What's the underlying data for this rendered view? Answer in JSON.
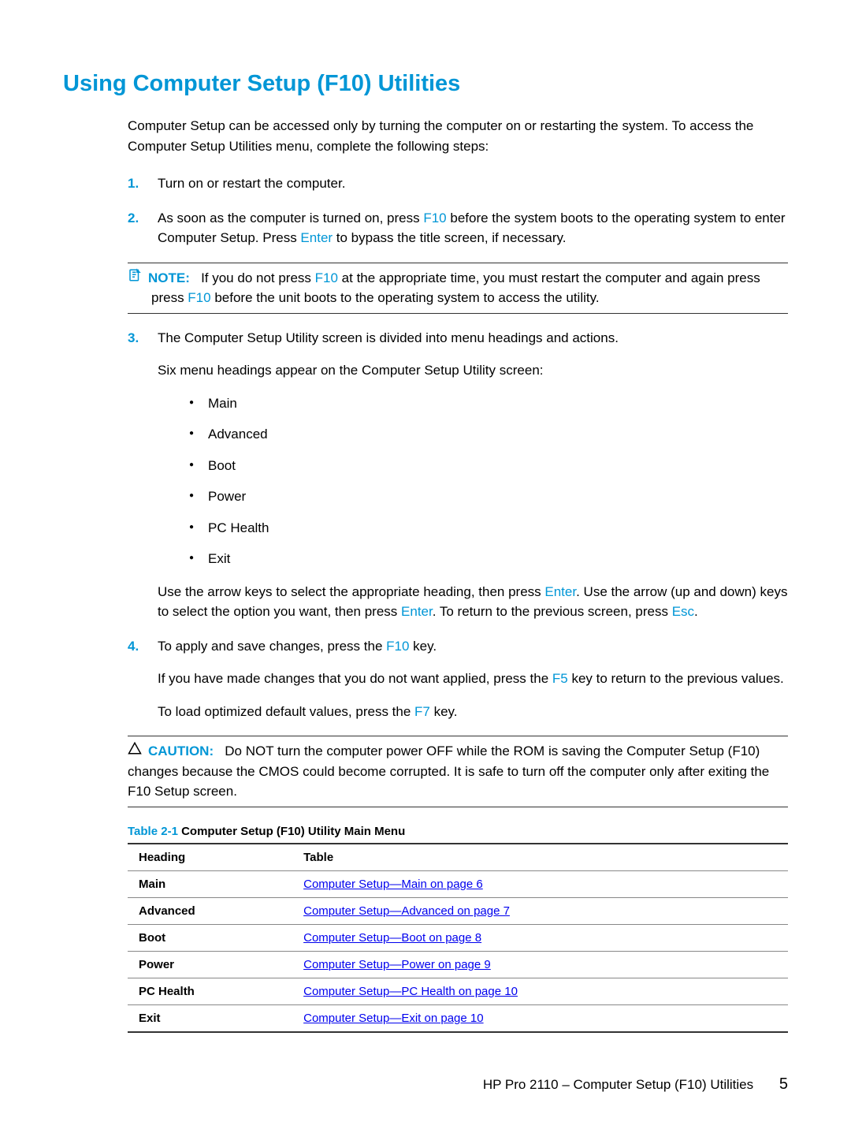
{
  "title": "Using Computer Setup (F10) Utilities",
  "intro": "Computer Setup can be accessed only by turning the computer on or restarting the system. To access the Computer Setup Utilities menu, complete the following steps:",
  "steps": {
    "s1_num": "1.",
    "s1_text": "Turn on or restart the computer.",
    "s2_num": "2.",
    "s2_a": "As soon as the computer is turned on, press ",
    "s2_key1": "F10",
    "s2_b": " before the system boots to the operating system to enter Computer Setup. Press ",
    "s2_key2": "Enter",
    "s2_c": " to bypass the title screen, if necessary.",
    "s3_num": "3.",
    "s3_text": "The Computer Setup Utility screen is divided into menu headings and actions.",
    "s3_sub": "Six menu headings appear on the Computer Setup Utility screen:",
    "s3_use_a": "Use the arrow keys to select the appropriate heading, then press ",
    "s3_use_key1": "Enter",
    "s3_use_b": ". Use the arrow (up and down) keys to select the option you want, then press ",
    "s3_use_key2": "Enter",
    "s3_use_c": ". To return to the previous screen, press ",
    "s3_use_key3": "Esc",
    "s3_use_d": ".",
    "s4_num": "4.",
    "s4_a": "To apply and save changes, press the ",
    "s4_key": "F10",
    "s4_b": " key.",
    "s4_p2_a": "If you have made changes that you do not want applied, press the ",
    "s4_p2_key": "F5",
    "s4_p2_b": " key to return to the previous values.",
    "s4_p3_a": "To load optimized default values, press the ",
    "s4_p3_key": "F7",
    "s4_p3_b": " key."
  },
  "menu_items": [
    "Main",
    "Advanced",
    "Boot",
    "Power",
    "PC Health",
    "Exit"
  ],
  "note": {
    "label": "NOTE:",
    "a": "If you do not press ",
    "key1": "F10",
    "b": " at the appropriate time, you must restart the computer and again press ",
    "key2": "F10",
    "c": " before the unit boots to the operating system to access the utility."
  },
  "caution": {
    "label": "CAUTION:",
    "text": "Do NOT turn the computer power OFF while the ROM is saving the Computer Setup (F10) changes because the CMOS could become corrupted. It is safe to turn off the computer only after exiting the F10 Setup screen."
  },
  "table": {
    "title_prefix": "Table 2-1",
    "title_text": "  Computer Setup (F10) Utility Main Menu",
    "col1": "Heading",
    "col2": "Table",
    "rows": [
      {
        "h": "Main",
        "link": "Computer Setup—Main on page 6"
      },
      {
        "h": "Advanced",
        "link": "Computer Setup—Advanced on page 7"
      },
      {
        "h": "Boot",
        "link": "Computer Setup—Boot on page 8"
      },
      {
        "h": "Power",
        "link": "Computer Setup—Power on page 9"
      },
      {
        "h": "PC Health",
        "link": "Computer Setup—PC Health on page 10"
      },
      {
        "h": "Exit",
        "link": "Computer Setup—Exit on page 10"
      }
    ]
  },
  "footer": {
    "text": "HP Pro 2110 – Computer Setup (F10) Utilities",
    "page": "5"
  }
}
